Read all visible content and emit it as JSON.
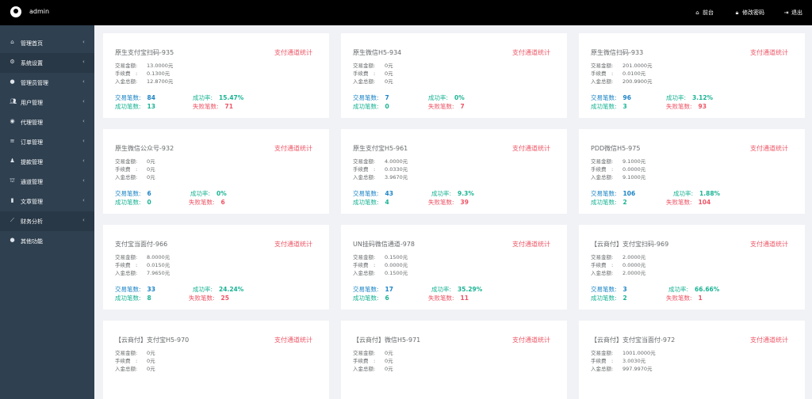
{
  "header": {
    "username": "admin",
    "nav": [
      {
        "label": "前台",
        "icon": "home-icon"
      },
      {
        "label": "修改密码",
        "icon": "lock-icon"
      },
      {
        "label": "退出",
        "icon": "logout-icon"
      }
    ]
  },
  "sidebar": {
    "items": [
      {
        "label": "管理首页",
        "icon": "home-icon"
      },
      {
        "label": "系统设置",
        "icon": "gears-icon"
      },
      {
        "label": "管理员管理",
        "icon": "user-circle-icon"
      },
      {
        "label": "用户管理",
        "icon": "users-icon"
      },
      {
        "label": "代理管理",
        "icon": "eye-icon"
      },
      {
        "label": "订单管理",
        "icon": "list-icon"
      },
      {
        "label": "提款管理",
        "icon": "money-bag-icon"
      },
      {
        "label": "通道管理",
        "icon": "bank-icon"
      },
      {
        "label": "文章管理",
        "icon": "book-icon"
      },
      {
        "label": "财务分析",
        "icon": "line-chart-icon"
      },
      {
        "label": "其他功能",
        "icon": "user-circle-icon"
      }
    ]
  },
  "labels": {
    "stats_link": "支付通道统计",
    "trade_amount": "交易金额:",
    "fee": "手续费　:",
    "income": "入金总额:",
    "trade_count": "交易笔数:",
    "success_rate": "成功率:",
    "success_count": "成功笔数:",
    "fail_count": "失败笔数:"
  },
  "cards": [
    {
      "name": "原生支付宝扫码-935",
      "amount": "13.0000元",
      "fee": "0.1300元",
      "income": "12.8700元",
      "trades": "84",
      "rate": "15.47%",
      "success": "13",
      "fail": "71"
    },
    {
      "name": "原生微信H5-934",
      "amount": "0元",
      "fee": "0元",
      "income": "0元",
      "trades": "7",
      "rate": "0%",
      "success": "0",
      "fail": "7"
    },
    {
      "name": "原生微信扫码-933",
      "amount": "201.0000元",
      "fee": "0.0100元",
      "income": "200.9900元",
      "trades": "96",
      "rate": "3.12%",
      "success": "3",
      "fail": "93"
    },
    {
      "name": "原生微信公众号-932",
      "amount": "0元",
      "fee": "0元",
      "income": "0元",
      "trades": "6",
      "rate": "0%",
      "success": "0",
      "fail": "6"
    },
    {
      "name": "原生支付宝H5-961",
      "amount": "4.0000元",
      "fee": "0.0330元",
      "income": "3.9670元",
      "trades": "43",
      "rate": "9.3%",
      "success": "4",
      "fail": "39"
    },
    {
      "name": "PDD微信H5-975",
      "amount": "9.1000元",
      "fee": "0.0000元",
      "income": "9.1000元",
      "trades": "106",
      "rate": "1.88%",
      "success": "2",
      "fail": "104"
    },
    {
      "name": "支付宝当面付-966",
      "amount": "8.0000元",
      "fee": "0.0150元",
      "income": "7.9650元",
      "trades": "33",
      "rate": "24.24%",
      "success": "8",
      "fail": "25"
    },
    {
      "name": "UN挂码微信通道-978",
      "amount": "0.1500元",
      "fee": "0.0000元",
      "income": "0.1500元",
      "trades": "17",
      "rate": "35.29%",
      "success": "6",
      "fail": "11"
    },
    {
      "name": "【云商付】支付宝扫码-969",
      "amount": "2.0000元",
      "fee": "0.0000元",
      "income": "2.0000元",
      "trades": "3",
      "rate": "66.66%",
      "success": "2",
      "fail": "1"
    },
    {
      "name": "【云商付】支付宝H5-970",
      "amount": "0元",
      "fee": "0元",
      "income": "0元"
    },
    {
      "name": "【云商付】微信H5-971",
      "amount": "0元",
      "fee": "0元",
      "income": "0元"
    },
    {
      "name": "【云商付】支付宝当面付-972",
      "amount": "1001.0000元",
      "fee": "3.0030元",
      "income": "997.9970元"
    }
  ],
  "colors": {
    "topbar": "#000000",
    "sidebar": "#2f4050",
    "link_red": "#ed5565",
    "blue": "#1c84c6",
    "green": "#1ab394"
  }
}
